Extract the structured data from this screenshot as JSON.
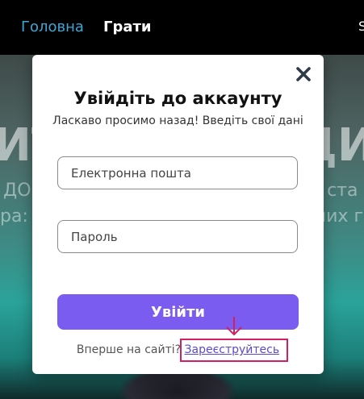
{
  "nav": {
    "home_label": "Головна",
    "play_label": "Грати",
    "edge_label": "S"
  },
  "hero": {
    "big_left": "ИТУ",
    "big_right": "ДИ",
    "line1_left": "ДОВ",
    "line2_left": "ра: р",
    "line1_right": "с ста",
    "line2_right": "ших г"
  },
  "modal": {
    "title": "Увійдіть до аккаунту",
    "subtitle": "Ласкаво просимо назад! Введіть свої дані",
    "email_placeholder": "Електронна пошта",
    "password_placeholder": "Пароль",
    "login_label": "Увійти",
    "signup_prompt": "Вперше на сайті?",
    "signup_link": "Зареєструйтесь"
  },
  "colors": {
    "accent": "#7b5cf0",
    "nav_active": "#3aa8d8",
    "highlight": "#d21f5e",
    "link": "#5b4bc8"
  },
  "icons": {
    "close": "close-icon",
    "highlight_arrow": "arrow-down-icon"
  }
}
